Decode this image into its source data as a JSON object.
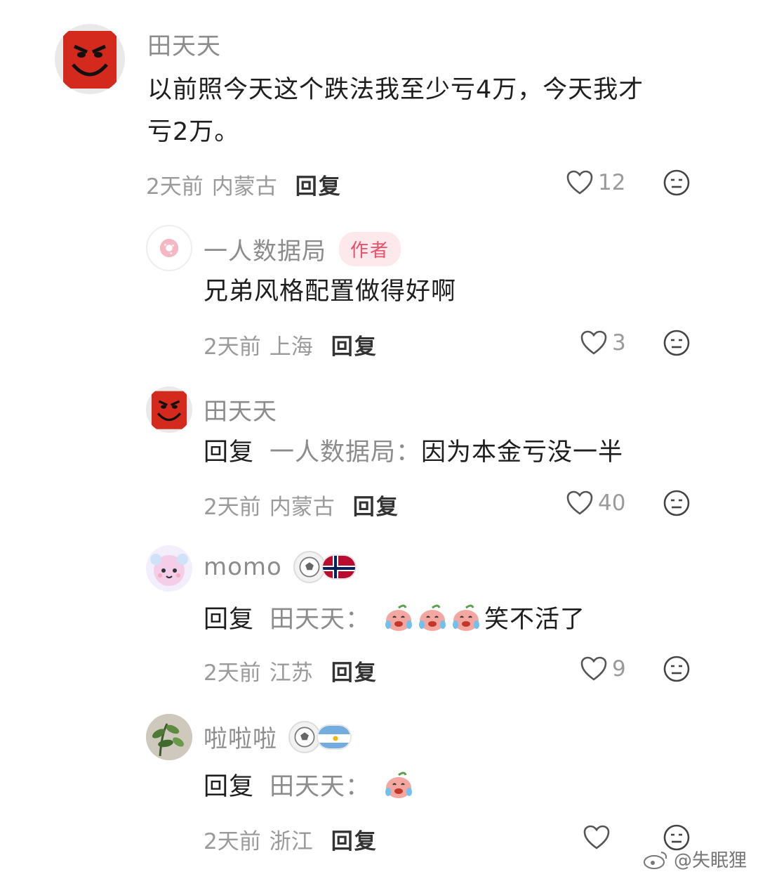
{
  "comments": [
    {
      "username": "田天天",
      "text_line1": "以前照今天这个跌法我至少亏4万，今天我才",
      "text_line2": "亏2万。",
      "time": "2天前",
      "location": "内蒙古",
      "reply_label": "回复",
      "likes": "12"
    },
    {
      "username": "一人数据局",
      "author_badge": "作者",
      "text": "兄弟风格配置做得好啊",
      "time": "2天前",
      "location": "上海",
      "reply_label": "回复",
      "likes": "3"
    },
    {
      "username": "田天天",
      "reply_prefix": "回复",
      "reply_target": "一人数据局：",
      "text": "因为本金亏没一半",
      "time": "2天前",
      "location": "内蒙古",
      "reply_label": "回复",
      "likes": "40"
    },
    {
      "username": "momo",
      "reply_prefix": "回复",
      "reply_target": "田天天：",
      "text": "笑不活了",
      "time": "2天前",
      "location": "江苏",
      "reply_label": "回复",
      "likes": "9"
    },
    {
      "username": "啦啦啦",
      "reply_prefix": "回复",
      "reply_target": "田天天：",
      "text": "",
      "time": "2天前",
      "location": "浙江",
      "reply_label": "回复",
      "likes": ""
    }
  ],
  "watermark": "@失眠狸",
  "icons": {
    "like": "heart-outline-icon",
    "dislike": "neutral-face-icon",
    "emoji": "crying-laugh-peach-emoji"
  },
  "colors": {
    "username": "#8c8c8c",
    "author_badge_bg": "#fde8ec",
    "author_badge_text": "#e8506a",
    "avatar_red": "#d42a1e"
  }
}
